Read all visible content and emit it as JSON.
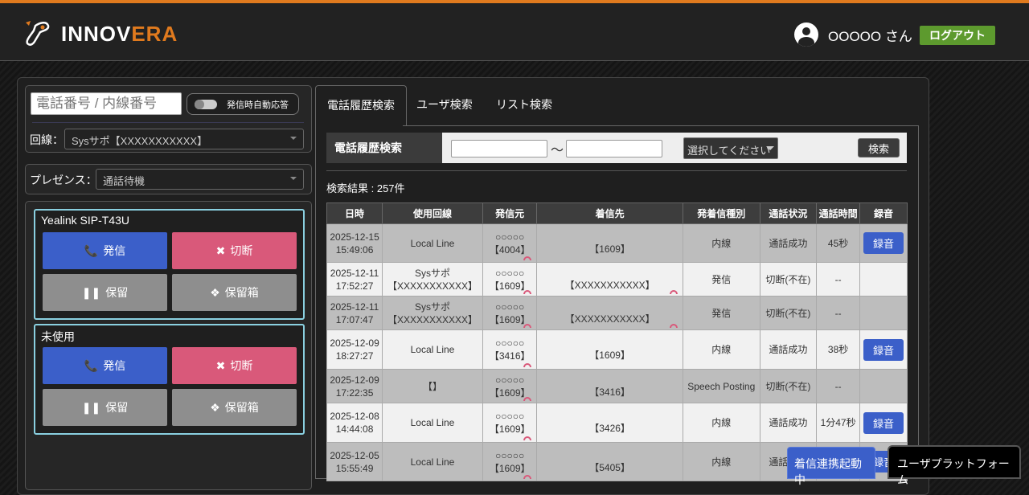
{
  "header": {
    "logo_main": "INNOV",
    "logo_accent": "ERA",
    "user_name": "OOOOO さん",
    "logout": "ログアウト"
  },
  "left": {
    "phone_placeholder": "電話番号 / 内線番号",
    "auto_answer": "発信時自動応答",
    "line_label": "回線：",
    "line_value": "Sysサポ【XXXXXXXXXXX】",
    "presence_label": "プレゼンス：",
    "presence_value": "通話待機",
    "devices": [
      {
        "title": "Yealink SIP-T43U",
        "call": "発信",
        "hangup": "切断",
        "hold": "保留",
        "holdbox": "保留箱"
      },
      {
        "title": "未使用",
        "call": "発信",
        "hangup": "切断",
        "hold": "保留",
        "holdbox": "保留箱"
      }
    ]
  },
  "tabs": [
    {
      "label": "電話履歴検索",
      "active": true
    },
    {
      "label": "ユーザ検索"
    },
    {
      "label": "リスト検索"
    }
  ],
  "search": {
    "label": "電話履歴検索",
    "tilde": "～",
    "kind_placeholder": "選択してください",
    "button": "検索",
    "result_count": "検索結果 : 257件"
  },
  "table": {
    "headers": [
      "日時",
      "使用回線",
      "発信元",
      "着信先",
      "発着信種別",
      "通話状況",
      "通話時間",
      "録音"
    ],
    "rows": [
      {
        "date": "2025-12-15",
        "time": "15:49:06",
        "line1": "Local Line",
        "line2": "",
        "from1": "○○○○○",
        "from2": "【4004】",
        "to": "【1609】",
        "type": "内線",
        "status": "通話成功",
        "duration": "45秒",
        "rec": "録音"
      },
      {
        "date": "2025-12-11",
        "time": "17:52:27",
        "line1": "Sysサポ",
        "line2": "【XXXXXXXXXXX】",
        "from1": "○○○○○",
        "from2": "【1609】",
        "to": "【XXXXXXXXXXX】",
        "type": "発信",
        "status": "切断(不在)",
        "duration": "--",
        "rec": ""
      },
      {
        "date": "2025-12-11",
        "time": "17:07:47",
        "line1": "Sysサポ",
        "line2": "【XXXXXXXXXXX】",
        "from1": "○○○○○",
        "from2": "【1609】",
        "to": "【XXXXXXXXXXX】",
        "type": "発信",
        "status": "切断(不在)",
        "duration": "--",
        "rec": ""
      },
      {
        "date": "2025-12-09",
        "time": "18:27:27",
        "line1": "Local Line",
        "line2": "",
        "from1": "○○○○○",
        "from2": "【3416】",
        "to": "【1609】",
        "type": "内線",
        "status": "通話成功",
        "duration": "38秒",
        "rec": "録音"
      },
      {
        "date": "2025-12-09",
        "time": "17:22:35",
        "line1": "【】",
        "line2": "",
        "from1": "○○○○○",
        "from2": "【1609】",
        "to": "【3416】",
        "type": "Speech Posting",
        "status": "切断(不在)",
        "duration": "--",
        "rec": ""
      },
      {
        "date": "2025-12-08",
        "time": "14:44:08",
        "line1": "Local Line",
        "line2": "",
        "from1": "○○○○○",
        "from2": "【1609】",
        "to": "【3426】",
        "type": "内線",
        "status": "通話成功",
        "duration": "1分47秒",
        "rec": "録音"
      },
      {
        "date": "2025-12-05",
        "time": "15:55:49",
        "line1": "Local Line",
        "line2": "",
        "from1": "○○○○○",
        "from2": "【1609】",
        "to": "【5405】",
        "type": "内線",
        "status": "通話成功",
        "duration": "",
        "rec": "録音"
      }
    ]
  },
  "floating": {
    "incoming": "着信連携起動中",
    "platform": "ユーザプラットフォーム"
  },
  "colors": {
    "accent": "#e07a1e",
    "primary": "#3b5fc9",
    "danger": "#d9597a",
    "logout": "#5d9a2e"
  }
}
